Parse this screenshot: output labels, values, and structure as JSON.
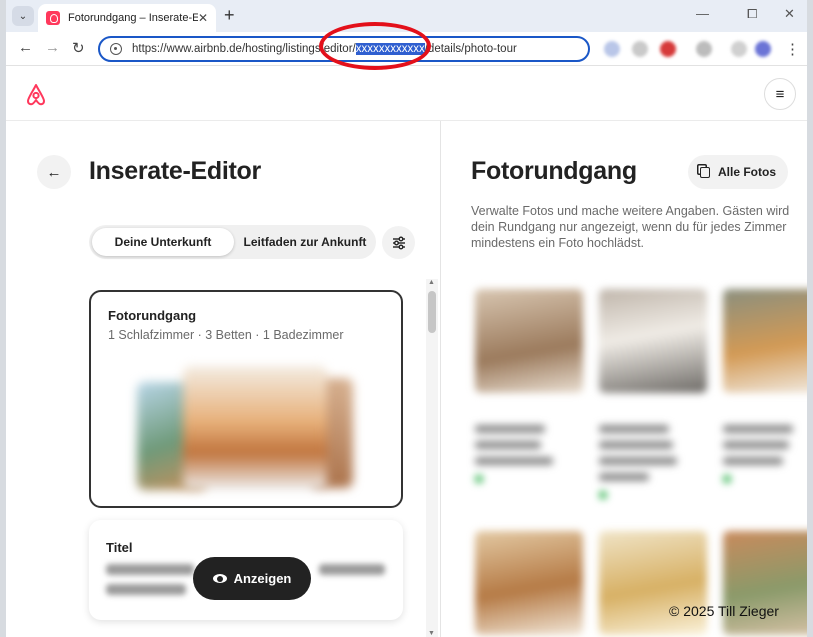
{
  "browser": {
    "tab_menu_icon": "chevron-down-icon",
    "tab_title": "Fotorundgang – Inserate-Editor",
    "tab_close": "✕",
    "new_tab": "+",
    "window_controls": [
      "—",
      "⧠",
      "✕"
    ],
    "url_before": "https://www.airbnb.de/hosting/listings/editor/",
    "url_highlight": "xxxxxxxxxxxx",
    "url_after": "/details/photo-tour",
    "nav": {
      "back": "←",
      "forward": "→",
      "reload": "↻"
    }
  },
  "airbnb": {
    "brand_color": "#ff385c",
    "menu_icon": "≡"
  },
  "left": {
    "back_icon": "←",
    "title": "Inserate-Editor",
    "segment": {
      "tab1": "Deine Unterkunft",
      "tab2": "Leitfaden zur Ankunft"
    },
    "filter_icon": "sliders-icon",
    "card1": {
      "heading": "Fotorundgang",
      "subtitle": "1 Schlafzimmer · 3 Betten · 1 Badezimmer"
    },
    "card2": {
      "heading": "Titel"
    },
    "show_button": "Anzeigen"
  },
  "right": {
    "title": "Fotorundgang",
    "all_photos": "Alle Fotos",
    "description": "Verwalte Fotos und mache weitere Angaben. Gästen wird dein Rundgang nur angezeigt, wenn du für jedes Zimmer mindestens ein Foto hochlädst."
  },
  "annotation": {
    "ring_color": "#e3101a"
  },
  "watermark": "© 2025 Till Zieger"
}
